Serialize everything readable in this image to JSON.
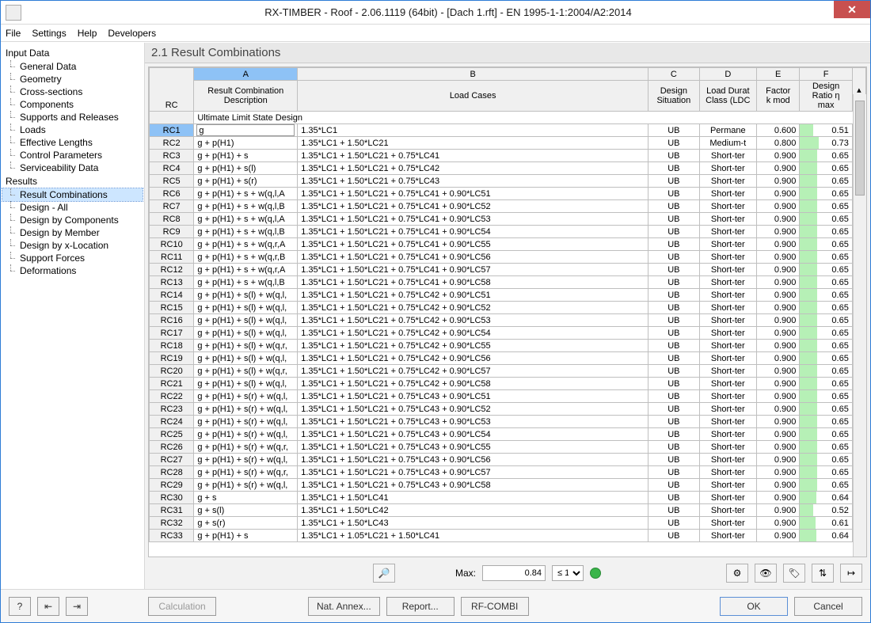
{
  "window": {
    "title": "RX-TIMBER - Roof - 2.06.1119 (64bit) - [Dach 1.rft] - EN 1995-1-1:2004/A2:2014"
  },
  "menu": [
    "File",
    "Settings",
    "Help",
    "Developers"
  ],
  "sidebar": {
    "groups": [
      {
        "title": "Input Data",
        "items": [
          "General Data",
          "Geometry",
          "Cross-sections",
          "Components",
          "Supports and Releases",
          "Loads",
          "Effective Lengths",
          "Control Parameters",
          "Serviceability Data"
        ]
      },
      {
        "title": "Results",
        "items": [
          "Result Combinations",
          "Design - All",
          "Design by Components",
          "Design by Member",
          "Design by x-Location",
          "Support Forces",
          "Deformations"
        ],
        "selected": 0
      }
    ]
  },
  "main": {
    "title": "2.1 Result Combinations",
    "col_letters": [
      "A",
      "B",
      "C",
      "D",
      "E",
      "F"
    ],
    "headers": {
      "rc": "RC",
      "desc1": "Result Combination",
      "desc2": "Description",
      "lc": "Load Cases",
      "sit1": "Design",
      "sit2": "Situation",
      "ldc1": "Load Durat",
      "ldc2": "Class (LDC",
      "factor1": "Factor",
      "factor2": "k mod",
      "ratio1": "Design",
      "ratio2": "Ratio η max"
    },
    "section": "Ultimate Limit State Design",
    "rows": [
      {
        "rc": "RC1",
        "desc": "g",
        "lc": "1.35*LC1",
        "sit": "UB",
        "ldc": "Permane",
        "kmod": "0.600",
        "ratio": 0.51
      },
      {
        "rc": "RC2",
        "desc": "g + p(H1)",
        "lc": "1.35*LC1 + 1.50*LC21",
        "sit": "UB",
        "ldc": "Medium-t",
        "kmod": "0.800",
        "ratio": 0.73
      },
      {
        "rc": "RC3",
        "desc": "g + p(H1) + s",
        "lc": "1.35*LC1 + 1.50*LC21 + 0.75*LC41",
        "sit": "UB",
        "ldc": "Short-ter",
        "kmod": "0.900",
        "ratio": 0.65
      },
      {
        "rc": "RC4",
        "desc": "g + p(H1) + s(l)",
        "lc": "1.35*LC1 + 1.50*LC21 + 0.75*LC42",
        "sit": "UB",
        "ldc": "Short-ter",
        "kmod": "0.900",
        "ratio": 0.65
      },
      {
        "rc": "RC5",
        "desc": "g + p(H1) + s(r)",
        "lc": "1.35*LC1 + 1.50*LC21 + 0.75*LC43",
        "sit": "UB",
        "ldc": "Short-ter",
        "kmod": "0.900",
        "ratio": 0.65
      },
      {
        "rc": "RC6",
        "desc": "g + p(H1) + s + w(q,l,A",
        "lc": "1.35*LC1 + 1.50*LC21 + 0.75*LC41 + 0.90*LC51",
        "sit": "UB",
        "ldc": "Short-ter",
        "kmod": "0.900",
        "ratio": 0.65
      },
      {
        "rc": "RC7",
        "desc": "g + p(H1) + s + w(q,l,B",
        "lc": "1.35*LC1 + 1.50*LC21 + 0.75*LC41 + 0.90*LC52",
        "sit": "UB",
        "ldc": "Short-ter",
        "kmod": "0.900",
        "ratio": 0.65
      },
      {
        "rc": "RC8",
        "desc": "g + p(H1) + s + w(q,l,A",
        "lc": "1.35*LC1 + 1.50*LC21 + 0.75*LC41 + 0.90*LC53",
        "sit": "UB",
        "ldc": "Short-ter",
        "kmod": "0.900",
        "ratio": 0.65
      },
      {
        "rc": "RC9",
        "desc": "g + p(H1) + s + w(q,l,B",
        "lc": "1.35*LC1 + 1.50*LC21 + 0.75*LC41 + 0.90*LC54",
        "sit": "UB",
        "ldc": "Short-ter",
        "kmod": "0.900",
        "ratio": 0.65
      },
      {
        "rc": "RC10",
        "desc": "g + p(H1) + s + w(q,r,A",
        "lc": "1.35*LC1 + 1.50*LC21 + 0.75*LC41 + 0.90*LC55",
        "sit": "UB",
        "ldc": "Short-ter",
        "kmod": "0.900",
        "ratio": 0.65
      },
      {
        "rc": "RC11",
        "desc": "g + p(H1) + s + w(q,r,B",
        "lc": "1.35*LC1 + 1.50*LC21 + 0.75*LC41 + 0.90*LC56",
        "sit": "UB",
        "ldc": "Short-ter",
        "kmod": "0.900",
        "ratio": 0.65
      },
      {
        "rc": "RC12",
        "desc": "g + p(H1) + s + w(q,r,A",
        "lc": "1.35*LC1 + 1.50*LC21 + 0.75*LC41 + 0.90*LC57",
        "sit": "UB",
        "ldc": "Short-ter",
        "kmod": "0.900",
        "ratio": 0.65
      },
      {
        "rc": "RC13",
        "desc": "g + p(H1) + s + w(q,l,B",
        "lc": "1.35*LC1 + 1.50*LC21 + 0.75*LC41 + 0.90*LC58",
        "sit": "UB",
        "ldc": "Short-ter",
        "kmod": "0.900",
        "ratio": 0.65
      },
      {
        "rc": "RC14",
        "desc": "g + p(H1) + s(l) + w(q,l,",
        "lc": "1.35*LC1 + 1.50*LC21 + 0.75*LC42 + 0.90*LC51",
        "sit": "UB",
        "ldc": "Short-ter",
        "kmod": "0.900",
        "ratio": 0.65
      },
      {
        "rc": "RC15",
        "desc": "g + p(H1) + s(l) + w(q,l,",
        "lc": "1.35*LC1 + 1.50*LC21 + 0.75*LC42 + 0.90*LC52",
        "sit": "UB",
        "ldc": "Short-ter",
        "kmod": "0.900",
        "ratio": 0.65
      },
      {
        "rc": "RC16",
        "desc": "g + p(H1) + s(l) + w(q,l,",
        "lc": "1.35*LC1 + 1.50*LC21 + 0.75*LC42 + 0.90*LC53",
        "sit": "UB",
        "ldc": "Short-ter",
        "kmod": "0.900",
        "ratio": 0.65
      },
      {
        "rc": "RC17",
        "desc": "g + p(H1) + s(l) + w(q,l,",
        "lc": "1.35*LC1 + 1.50*LC21 + 0.75*LC42 + 0.90*LC54",
        "sit": "UB",
        "ldc": "Short-ter",
        "kmod": "0.900",
        "ratio": 0.65
      },
      {
        "rc": "RC18",
        "desc": "g + p(H1) + s(l) + w(q,r,",
        "lc": "1.35*LC1 + 1.50*LC21 + 0.75*LC42 + 0.90*LC55",
        "sit": "UB",
        "ldc": "Short-ter",
        "kmod": "0.900",
        "ratio": 0.65
      },
      {
        "rc": "RC19",
        "desc": "g + p(H1) + s(l) + w(q,l,",
        "lc": "1.35*LC1 + 1.50*LC21 + 0.75*LC42 + 0.90*LC56",
        "sit": "UB",
        "ldc": "Short-ter",
        "kmod": "0.900",
        "ratio": 0.65
      },
      {
        "rc": "RC20",
        "desc": "g + p(H1) + s(l) + w(q,r,",
        "lc": "1.35*LC1 + 1.50*LC21 + 0.75*LC42 + 0.90*LC57",
        "sit": "UB",
        "ldc": "Short-ter",
        "kmod": "0.900",
        "ratio": 0.65
      },
      {
        "rc": "RC21",
        "desc": "g + p(H1) + s(l) + w(q,l,",
        "lc": "1.35*LC1 + 1.50*LC21 + 0.75*LC42 + 0.90*LC58",
        "sit": "UB",
        "ldc": "Short-ter",
        "kmod": "0.900",
        "ratio": 0.65
      },
      {
        "rc": "RC22",
        "desc": "g + p(H1) + s(r) + w(q,l,",
        "lc": "1.35*LC1 + 1.50*LC21 + 0.75*LC43 + 0.90*LC51",
        "sit": "UB",
        "ldc": "Short-ter",
        "kmod": "0.900",
        "ratio": 0.65
      },
      {
        "rc": "RC23",
        "desc": "g + p(H1) + s(r) + w(q,l,",
        "lc": "1.35*LC1 + 1.50*LC21 + 0.75*LC43 + 0.90*LC52",
        "sit": "UB",
        "ldc": "Short-ter",
        "kmod": "0.900",
        "ratio": 0.65
      },
      {
        "rc": "RC24",
        "desc": "g + p(H1) + s(r) + w(q,l,",
        "lc": "1.35*LC1 + 1.50*LC21 + 0.75*LC43 + 0.90*LC53",
        "sit": "UB",
        "ldc": "Short-ter",
        "kmod": "0.900",
        "ratio": 0.65
      },
      {
        "rc": "RC25",
        "desc": "g + p(H1) + s(r) + w(q,l,",
        "lc": "1.35*LC1 + 1.50*LC21 + 0.75*LC43 + 0.90*LC54",
        "sit": "UB",
        "ldc": "Short-ter",
        "kmod": "0.900",
        "ratio": 0.65
      },
      {
        "rc": "RC26",
        "desc": "g + p(H1) + s(r) + w(q,r,",
        "lc": "1.35*LC1 + 1.50*LC21 + 0.75*LC43 + 0.90*LC55",
        "sit": "UB",
        "ldc": "Short-ter",
        "kmod": "0.900",
        "ratio": 0.65
      },
      {
        "rc": "RC27",
        "desc": "g + p(H1) + s(r) + w(q,l,",
        "lc": "1.35*LC1 + 1.50*LC21 + 0.75*LC43 + 0.90*LC56",
        "sit": "UB",
        "ldc": "Short-ter",
        "kmod": "0.900",
        "ratio": 0.65
      },
      {
        "rc": "RC28",
        "desc": "g + p(H1) + s(r) + w(q,r,",
        "lc": "1.35*LC1 + 1.50*LC21 + 0.75*LC43 + 0.90*LC57",
        "sit": "UB",
        "ldc": "Short-ter",
        "kmod": "0.900",
        "ratio": 0.65
      },
      {
        "rc": "RC29",
        "desc": "g + p(H1) + s(r) + w(q,l,",
        "lc": "1.35*LC1 + 1.50*LC21 + 0.75*LC43 + 0.90*LC58",
        "sit": "UB",
        "ldc": "Short-ter",
        "kmod": "0.900",
        "ratio": 0.65
      },
      {
        "rc": "RC30",
        "desc": "g + s",
        "lc": "1.35*LC1 + 1.50*LC41",
        "sit": "UB",
        "ldc": "Short-ter",
        "kmod": "0.900",
        "ratio": 0.64
      },
      {
        "rc": "RC31",
        "desc": "g + s(l)",
        "lc": "1.35*LC1 + 1.50*LC42",
        "sit": "UB",
        "ldc": "Short-ter",
        "kmod": "0.900",
        "ratio": 0.52
      },
      {
        "rc": "RC32",
        "desc": "g + s(r)",
        "lc": "1.35*LC1 + 1.50*LC43",
        "sit": "UB",
        "ldc": "Short-ter",
        "kmod": "0.900",
        "ratio": 0.61
      },
      {
        "rc": "RC33",
        "desc": "g + p(H1) + s",
        "lc": "1.35*LC1 + 1.05*LC21 + 1.50*LC41",
        "sit": "UB",
        "ldc": "Short-ter",
        "kmod": "0.900",
        "ratio": 0.64
      }
    ]
  },
  "toolbar": {
    "max_label": "Max:",
    "max_value": "0.84",
    "comparator": "≤ 1"
  },
  "footer": {
    "calculation": "Calculation",
    "nat_annex": "Nat. Annex...",
    "report": "Report...",
    "rfcombi": "RF-COMBI",
    "ok": "OK",
    "cancel": "Cancel"
  }
}
